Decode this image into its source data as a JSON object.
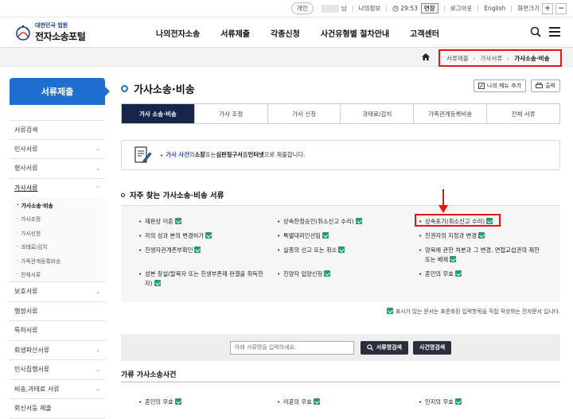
{
  "topbar": {
    "personal": "개인",
    "user_suffix": "님",
    "myinfo": "나의정보",
    "timer": "29:53",
    "extend": "연장",
    "logout": "로그아웃",
    "english": "English",
    "zoom": "화면크기",
    "zoom_in": "+",
    "zoom_out": "−"
  },
  "header": {
    "logo_small": "대한민국 법원",
    "logo_big": "전자소송포털",
    "nav": [
      "나의전자소송",
      "서류제출",
      "각종신청",
      "사건유형별 절차안내",
      "고객센터"
    ]
  },
  "breadcrumb": {
    "items": [
      "서류제출",
      "가사서류"
    ],
    "current": "가사소송·비송",
    "sep": "›"
  },
  "sidebar": {
    "title": "서류제출",
    "items_before": [
      {
        "label": "서류검색",
        "chev": ""
      },
      {
        "label": "민사서류",
        "chev": "⌄"
      },
      {
        "label": "형사서류",
        "chev": "⌄"
      }
    ],
    "open_item": {
      "label": "가사서류",
      "chev": "⌃"
    },
    "subs": [
      "가사소송·비송",
      "가사조정",
      "가사신청",
      "과태료/감치",
      "가족관계등록비송",
      "전체서류"
    ],
    "items_after": [
      {
        "label": "보호서류",
        "chev": "⌄"
      },
      {
        "label": "행정서류",
        "chev": ""
      },
      {
        "label": "특허서류",
        "chev": ""
      },
      {
        "label": "회생파산서류",
        "chev": "⌄"
      },
      {
        "label": "민사집행서류",
        "chev": "⌄"
      },
      {
        "label": "비송,과태료 서류",
        "chev": "⌄"
      },
      {
        "label": "회신서등 제출",
        "chev": ""
      }
    ]
  },
  "page": {
    "title": "가사소송·비송",
    "btn_menu": "나의 메뉴 추가",
    "btn_print": "출력",
    "tabs": [
      "가사 소송·비송",
      "가사 조정",
      "가사 신청",
      "과태료/감치",
      "가족관계등록비송",
      "전체 서류"
    ],
    "notice": {
      "p1": "가사 사건",
      "p2": "의 ",
      "p3": "소장",
      "p4": " 또는 ",
      "p5": "심판청구서",
      "p6": "를 ",
      "p7": "인터넷",
      "p8": "으로 제출합니다."
    },
    "section_title": "자주 찾는 가사소송·비송 서류",
    "docs": [
      [
        "재판상 이혼",
        "상속한정승인(취소신고 수리)",
        "상속포기(취소신고 수리)"
      ],
      [
        "자의 성과 본의 변경허가",
        "특별대리인선임",
        "친권자의 지정과 변경"
      ],
      [
        "친생자관계존부확인",
        "실종의 선고 또는 취소",
        "양육에 관한 처분과 그 변경, 면접교섭권의 제한 또는 배제"
      ],
      [
        "성본 창설(탈북자 또는 친생부존재 판결을 취득한 자)",
        "친양자 입양신청",
        "혼인의 무효"
      ]
    ],
    "legend_note": "표시가 있는 문서는 표준화된 입력항목을 직접 작성하는 전자문서 입니다.",
    "search_placeholder": "아래 서류명을 입력하세요.",
    "search_btn": "서류명검색",
    "case_btn": "사건명검색",
    "section2_title": "가류 가사소송사건",
    "docs2": [
      "혼인의 무효",
      "이혼의 무효",
      "인지의 무효"
    ]
  },
  "colors": {
    "accent": "#1e6fcf",
    "tab_active": "#15254b",
    "highlight": "#e11111",
    "doc_icon": "#2b9b6d"
  }
}
